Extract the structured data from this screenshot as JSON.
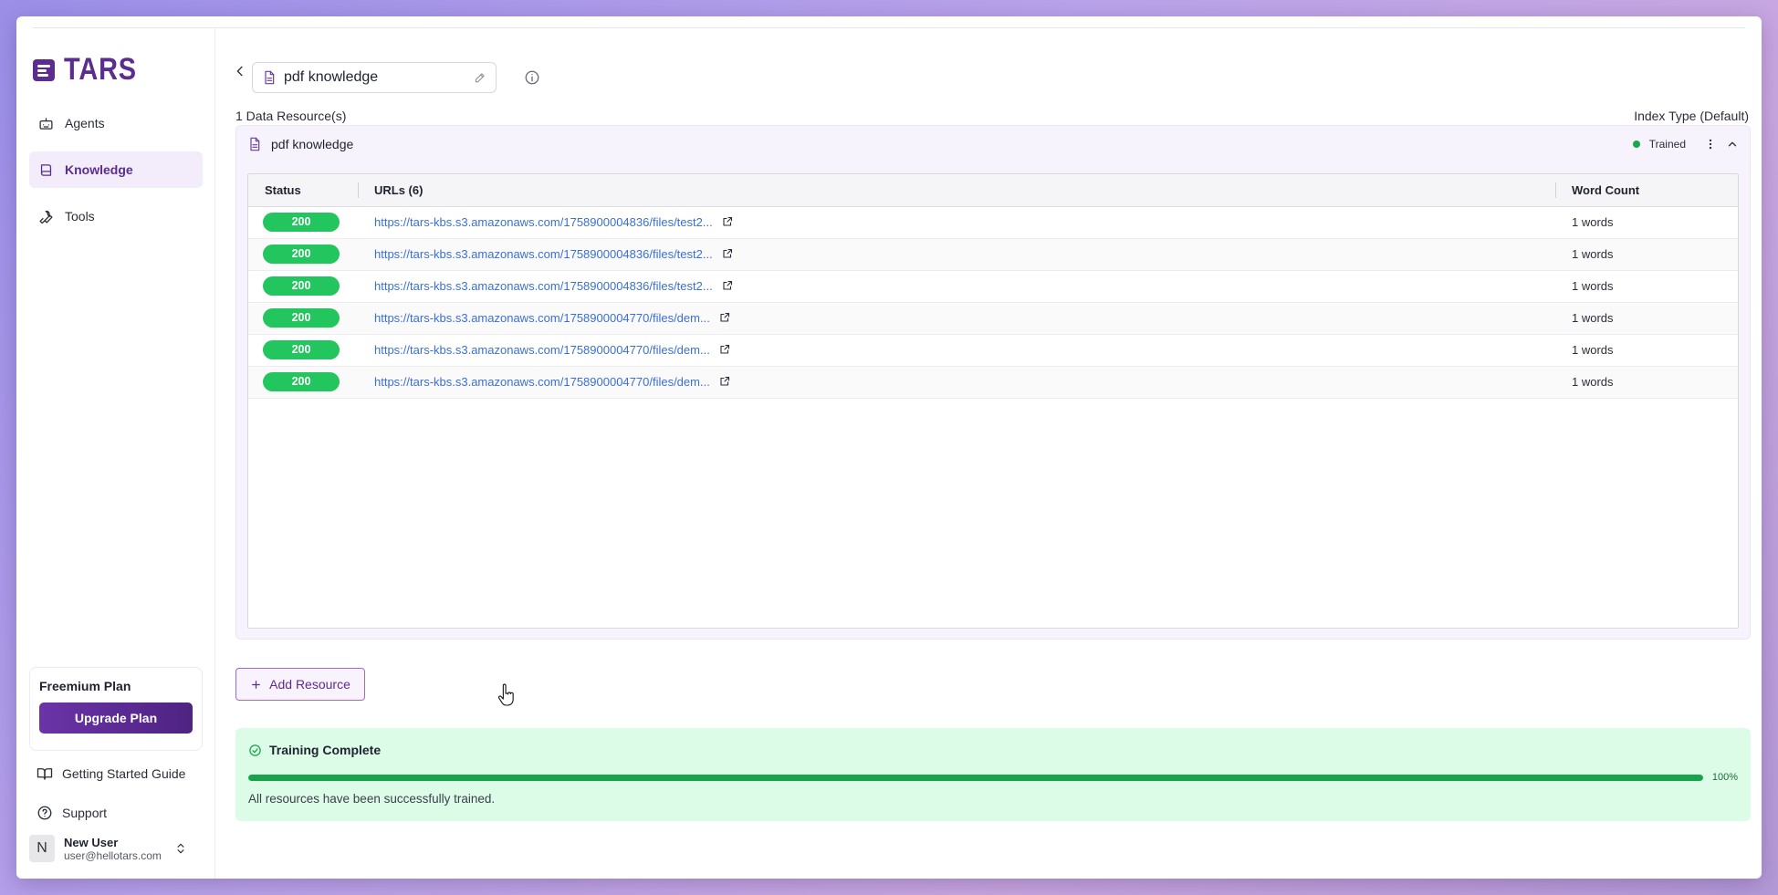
{
  "app": {
    "name": "TARS"
  },
  "sidebar": {
    "items": [
      {
        "label": "Agents",
        "icon": "robot-icon",
        "active": false
      },
      {
        "label": "Knowledge",
        "icon": "book-icon",
        "active": true
      },
      {
        "label": "Tools",
        "icon": "wrench-icon",
        "active": false
      }
    ],
    "plan": {
      "title": "Freemium Plan",
      "upgrade_label": "Upgrade Plan"
    },
    "guide_label": "Getting Started Guide",
    "support_label": "Support",
    "user": {
      "initial": "N",
      "name": "New User",
      "email": "user@hellotars.com"
    }
  },
  "header": {
    "title": "pdf knowledge"
  },
  "summary": {
    "count_label": "1 Data Resource(s)",
    "index_type": "Index Type (Default)"
  },
  "resource": {
    "name": "pdf knowledge",
    "status": "Trained",
    "status_color": "#1aa64a",
    "table": {
      "headers": {
        "status": "Status",
        "urls": "URLs (6)",
        "words": "Word Count"
      },
      "rows": [
        {
          "status": "200",
          "url": "https://tars-kbs.s3.amazonaws.com/1758900004836/files/test2...",
          "words": "1 words"
        },
        {
          "status": "200",
          "url": "https://tars-kbs.s3.amazonaws.com/1758900004836/files/test2...",
          "words": "1 words"
        },
        {
          "status": "200",
          "url": "https://tars-kbs.s3.amazonaws.com/1758900004836/files/test2...",
          "words": "1 words"
        },
        {
          "status": "200",
          "url": "https://tars-kbs.s3.amazonaws.com/1758900004770/files/dem...",
          "words": "1 words"
        },
        {
          "status": "200",
          "url": "https://tars-kbs.s3.amazonaws.com/1758900004770/files/dem...",
          "words": "1 words"
        },
        {
          "status": "200",
          "url": "https://tars-kbs.s3.amazonaws.com/1758900004770/files/dem...",
          "words": "1 words"
        }
      ]
    }
  },
  "actions": {
    "add_resource_label": "Add Resource"
  },
  "training": {
    "title": "Training Complete",
    "progress_percent": 100,
    "progress_label": "100%",
    "message": "All resources have been successfully trained."
  },
  "colors": {
    "brand": "#5b2d8e",
    "success": "#22c55e",
    "link": "#3a6fd8"
  }
}
